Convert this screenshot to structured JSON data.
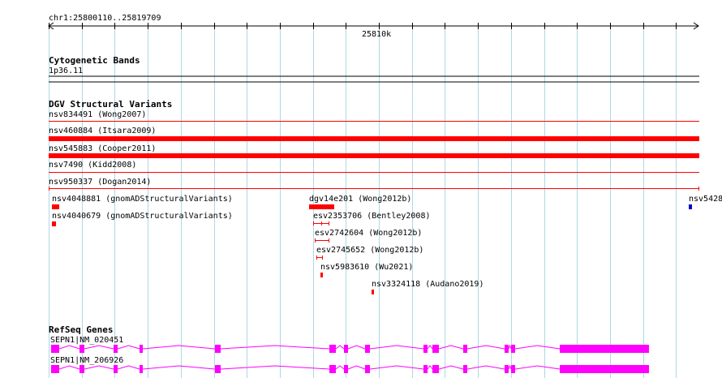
{
  "ruler": {
    "range_label": "chr1:25800110..25819709",
    "center_label": "25810k"
  },
  "cytoband": {
    "title": "Cytogenetic Bands",
    "band_label": "1p36.11"
  },
  "dgv": {
    "title": "DGV Structural Variants",
    "tracks": [
      {
        "label": "nsv834491 (Wong2007)",
        "style": "thin"
      },
      {
        "label": "nsv460884 (Itsara2009)",
        "style": "thick"
      },
      {
        "label": "nsv545883 (Cooper2011)",
        "style": "thick"
      },
      {
        "label": "nsv7490 (Kidd2008)",
        "style": "thin"
      },
      {
        "label": "nsv950337 (Dogan2014)",
        "style": "ticked"
      }
    ],
    "features": [
      {
        "label": "nsv4048881 (gnomADStructuralVariants)",
        "mark": "block"
      },
      {
        "label": "nsv4040679 (gnomADStructuralVariants)",
        "mark": "dot"
      },
      {
        "label": "dgv14e201 (Wong2012b)",
        "mark": "block"
      },
      {
        "label": "esv2353706 (Bentley2008)",
        "mark": "bar"
      },
      {
        "label": "esv2742604 (Wong2012b)",
        "mark": "bar"
      },
      {
        "label": "esv2745652 (Wong2012b)",
        "mark": "bar"
      },
      {
        "label": "nsv5983610 (Wu2021)",
        "mark": "dot"
      },
      {
        "label": "nsv3324118 (Audano2019)",
        "mark": "dot"
      },
      {
        "label": "nsv5428",
        "mark": "blue"
      }
    ]
  },
  "refseq": {
    "title": "RefSeq Genes",
    "transcripts": [
      {
        "label": "SEPN1|NM_020451"
      },
      {
        "label": "SEPN1|NM_206926"
      }
    ]
  },
  "colors": {
    "grid": "#add8e6",
    "variant": "#ff0000",
    "gene": "#ff00ff",
    "blue_variant": "#0000cc",
    "text": "#000000"
  }
}
